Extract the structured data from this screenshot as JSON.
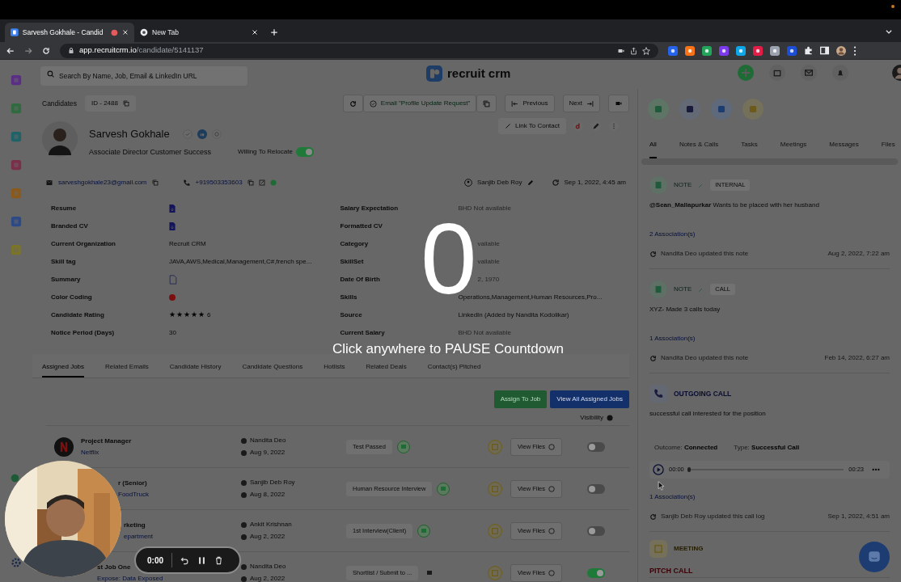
{
  "browser": {
    "tabs": [
      {
        "title": "Sarvesh Gokhale - Candid",
        "selected": true,
        "recording": true
      },
      {
        "title": "New Tab",
        "selected": false,
        "recording": false
      }
    ],
    "url_host": "app.recruitcrm.io",
    "url_path": "/candidate/5141137"
  },
  "header": {
    "search_placeholder": "Search By Name, Job, Email & LinkedIn URL",
    "logo": "recruit crm"
  },
  "toolbar": {
    "breadcrumb": "Candidates",
    "record_id": "ID - 2488",
    "email_action": "Email \"Profile Update Request\"",
    "previous": "Previous",
    "next": "Next"
  },
  "candidate": {
    "name": "Sarvesh Gokhale",
    "title": "Associate Director Customer Success",
    "relocate_label": "Willing To Relocate",
    "relocate_on": true,
    "link_contact": "Link To Contact",
    "email": "sarveshgokhale23@gmail.com",
    "phone": "+919503353603",
    "owner": "Sanjib Deb Roy",
    "updated": "Sep 1, 2022, 4:45 am"
  },
  "fields_left": [
    {
      "label": "Resume",
      "kind": "file"
    },
    {
      "label": "Branded CV",
      "kind": "file"
    },
    {
      "label": "Current Organization",
      "kind": "text",
      "value": "Recruit CRM"
    },
    {
      "label": "Skill tag",
      "kind": "text",
      "value": "JAVA,AWS,Medical,Management,C#,french spe..."
    },
    {
      "label": "Summary",
      "kind": "document"
    },
    {
      "label": "Color Coding",
      "kind": "color",
      "color": "#7a0f12"
    },
    {
      "label": "Candidate Rating",
      "kind": "rating",
      "stars": 5,
      "value": "6"
    },
    {
      "label": "Notice Period (Days)",
      "kind": "text",
      "value": "30"
    }
  ],
  "fields_right": [
    {
      "label": "Salary Expectation",
      "kind": "muted",
      "value": "BHD Not available"
    },
    {
      "label": "Formatted CV",
      "kind": "covered"
    },
    {
      "label": "Category",
      "kind": "covered",
      "value": "vailable"
    },
    {
      "label": "SkillSet",
      "kind": "covered",
      "value": "vailable"
    },
    {
      "label": "Date Of Birth",
      "kind": "covered",
      "value": "2, 1970"
    },
    {
      "label": "Skills",
      "kind": "text",
      "value": "Operations,Management,Human Resources,Pro..."
    },
    {
      "label": "Source",
      "kind": "text",
      "value": "LinkedIn (Added by Nandita Kodolikar)"
    },
    {
      "label": "Current Salary",
      "kind": "muted",
      "value": "BHD Not available"
    }
  ],
  "tabs": [
    {
      "label": "Assigned Jobs",
      "selected": true
    },
    {
      "label": "Related Emails",
      "selected": false
    },
    {
      "label": "Candidate History",
      "selected": false
    },
    {
      "label": "Candidate Questions",
      "selected": false
    },
    {
      "label": "Hotlists",
      "selected": false
    },
    {
      "label": "Related Deals",
      "selected": false
    },
    {
      "label": "Contact(s) Pitched",
      "selected": false
    }
  ],
  "jobs_actions": {
    "assign": "Assign To Job",
    "view_all": "View All Assigned Jobs",
    "visibility": "Visibility"
  },
  "jobs": [
    {
      "title": "Project Manager",
      "company": "Netflix",
      "has_logo": true,
      "assignee": "Nandita Deo",
      "date": "Aug 9, 2022",
      "stage": "Test Passed",
      "note_active": true,
      "files": "View Files",
      "visible": false
    },
    {
      "title": "r (Senior)",
      "company": "FoodTruck",
      "has_logo": false,
      "assignee": "Sanjib Deb Roy",
      "date": "Aug 8, 2022",
      "stage": "Human Resource Interview",
      "note_active": true,
      "files": "View Files",
      "visible": false
    },
    {
      "title": "rketing",
      "company": "epartment",
      "has_logo": false,
      "assignee": "Ankit Krishnan",
      "date": "Aug 2, 2022",
      "stage": "1st Interview(Client)",
      "note_active": true,
      "files": "View Files",
      "visible": false
    },
    {
      "title": "st Job One",
      "company": "Expose: Data Exposed",
      "has_logo": false,
      "assignee": "Nandita Deo",
      "date": "Aug 2, 2022",
      "stage": "Shortlist / Submit to ...",
      "note_active": false,
      "files": "View Files",
      "visible": true
    }
  ],
  "activity": {
    "tabs": [
      {
        "label": "All",
        "selected": true
      },
      {
        "label": "Notes & Calls",
        "selected": false
      },
      {
        "label": "Tasks",
        "selected": false
      },
      {
        "label": "Meetings",
        "selected": false
      },
      {
        "label": "Messages",
        "selected": false
      },
      {
        "label": "Files",
        "selected": false
      }
    ],
    "items": [
      {
        "kind": "note",
        "label": "NOTE",
        "tag": "INTERNAL",
        "text": "**@Sean_Mallapurkar** Wants to be placed with her husband",
        "associations": "2 Association(s)",
        "updated_by": "Nandita Deo updated this note",
        "date": "Aug 2, 2022, 7:22 am"
      },
      {
        "kind": "note",
        "label": "NOTE",
        "tag": "CALL",
        "text": "XYZ- Made 3 calls today",
        "associations": "1 Association(s)",
        "updated_by": "Nandita Deo updated this note",
        "date": "Feb 14, 2022, 6:27 am"
      },
      {
        "kind": "call",
        "label": "OUTGOING CALL",
        "text": "successful call interested for the position",
        "outcome_label": "Outcome:",
        "outcome": "Connected",
        "type_label": "Type:",
        "type": "Successful Call",
        "elapsed": "00:00",
        "duration": "00:23",
        "level": 0,
        "associations": "1 Association(s)",
        "updated_by": "Sanjib Deb Roy updated this call log",
        "date": "Sep 1, 2022, 4:51 am"
      },
      {
        "kind": "meeting",
        "label": "MEETING",
        "title": "PITCH CALL"
      }
    ]
  },
  "countdown": {
    "digit": "0",
    "message": "Click anywhere to PAUSE Countdown"
  },
  "recorder": {
    "time": "0:00"
  }
}
